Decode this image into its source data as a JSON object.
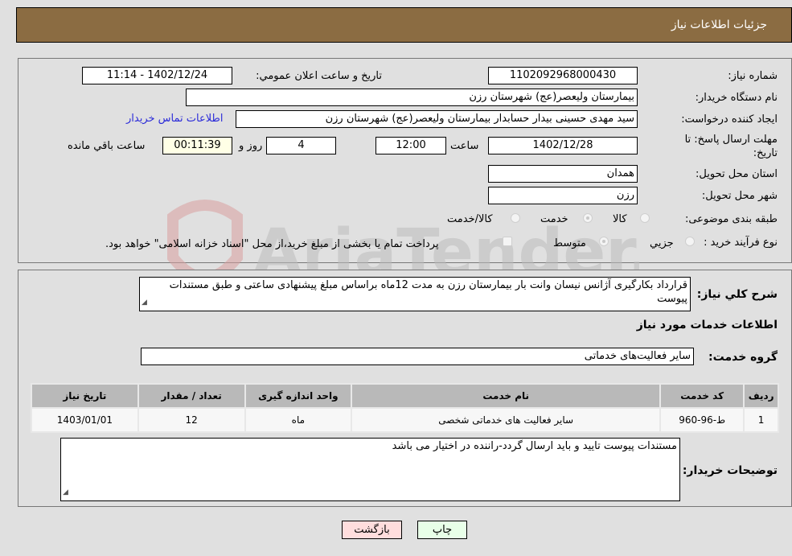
{
  "header": {
    "title": "جزئیات اطلاعات نیاز"
  },
  "fields": {
    "need_number": {
      "label": "شماره نیاز:",
      "value": "1102092968000430"
    },
    "announce_datetime": {
      "label": "تاریخ و ساعت اعلان عمومي:",
      "value": "1402/12/24 - 11:14"
    },
    "buyer_org": {
      "label": "نام دستگاه خریدار:",
      "value": "بیمارستان ولیعصر(عج) شهرستان رزن"
    },
    "requester": {
      "label": "ایجاد کننده درخواست:",
      "value": "سید مهدی حسینی بیدار حسابدار بیمارستان ولیعصر(عج) شهرستان رزن"
    },
    "buyer_contact_link": "اطلاعات تماس خریدار",
    "deadline": {
      "label_line1": "مهلت ارسال پاسخ: تا",
      "label_line2": "تاریخ:",
      "date": "1402/12/28",
      "time_label": "ساعت",
      "time": "12:00",
      "days": "4",
      "days_label": "روز و",
      "remaining": "00:11:39",
      "remaining_label": "ساعت باقي مانده"
    },
    "province": {
      "label": "استان محل تحویل:",
      "value": "همدان"
    },
    "city": {
      "label": "شهر محل تحویل:",
      "value": "رزن"
    },
    "category": {
      "label": "طبقه بندی موضوعی:",
      "options": [
        "کالا",
        "خدمت",
        "کالا/خدمت"
      ],
      "selected": "خدمت"
    },
    "purchase_type": {
      "label": "نوع فرآیند خرید :",
      "options": [
        "جزيي",
        "متوسط"
      ],
      "selected": "متوسط",
      "treasury_note": "پرداخت تمام یا بخشی از مبلغ خرید،از محل \"اسناد خزانه اسلامی\" خواهد بود."
    }
  },
  "description": {
    "label": "شرح کلي نياز:",
    "value": "قرارداد بکارگیری آژانس نیسان وانت بار بیمارستان رزن به مدت 12ماه براساس مبلغ پیشنهادی ساعتی و طبق مستندات پیوست"
  },
  "services_section_title": "اطلاعات خدمات مورد نیاز",
  "service_group": {
    "label": "گروه خدمت:",
    "value": "سایر فعالیت‌های خدماتی"
  },
  "table": {
    "headers": [
      "ردیف",
      "کد خدمت",
      "نام خدمت",
      "واحد اندازه گیری",
      "تعداد / مقدار",
      "تاریخ نیاز"
    ],
    "rows": [
      [
        "1",
        "ط-96-960",
        "سایر فعالیت های خدماتی شخصی",
        "ماه",
        "12",
        "1403/01/01"
      ]
    ]
  },
  "buyer_notes": {
    "label": "توضیحات خریدار:",
    "value": "مستندات پیوست تایید و باید ارسال گردد-راننده در اختیار می باشد"
  },
  "buttons": {
    "print": "چاپ",
    "back": "بازگشت"
  },
  "watermark": "AriaTender.net",
  "colors": {
    "header_bg": "#8b6c42",
    "back_btn": "#ffdddd",
    "print_btn": "#e8ffe8",
    "link": "#2b2bd9"
  }
}
